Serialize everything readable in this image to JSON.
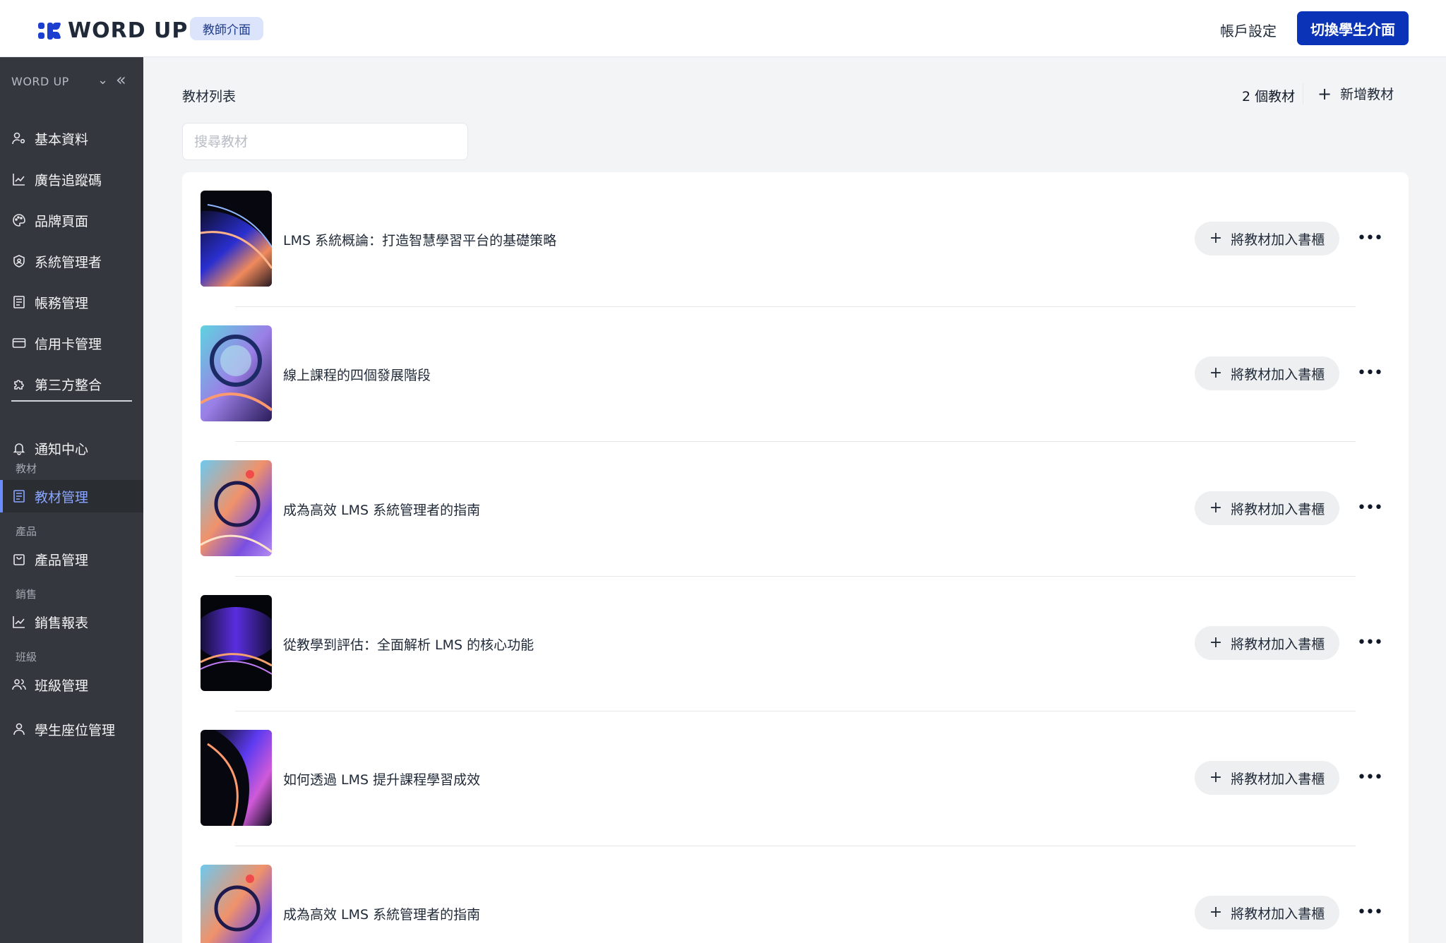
{
  "header": {
    "logo_text": "WORD UP",
    "role_badge": "教師介面",
    "account_settings": "帳戶設定",
    "switch_button": "切換學生介面",
    "accent_color": "#0a33b8"
  },
  "sidebar": {
    "brand": "WORD UP",
    "items": [
      {
        "label": "基本資料",
        "icon": "user-settings-icon"
      },
      {
        "label": "廣告追蹤碼",
        "icon": "line-chart-icon"
      },
      {
        "label": "品牌頁面",
        "icon": "palette-icon"
      },
      {
        "label": "系統管理者",
        "icon": "shield-icon"
      },
      {
        "label": "帳務管理",
        "icon": "document-icon"
      },
      {
        "label": "信用卡管理",
        "icon": "credit-card-icon"
      },
      {
        "label": "第三方整合",
        "icon": "puzzle-icon"
      },
      {
        "label": "通知中心",
        "icon": "bell-icon"
      }
    ],
    "sections": [
      {
        "label": "教材",
        "item": {
          "label": "教材管理",
          "icon": "book-icon",
          "active": true
        }
      },
      {
        "label": "產品",
        "item": {
          "label": "產品管理",
          "icon": "shopping-bag-icon"
        }
      },
      {
        "label": "銷售",
        "item": {
          "label": "銷售報表",
          "icon": "line-chart-icon"
        }
      },
      {
        "label": "班級",
        "item": {
          "label": "班級管理",
          "icon": "users-icon"
        }
      }
    ],
    "extra_item": {
      "label": "學生座位管理",
      "icon": "user-icon"
    }
  },
  "main": {
    "title": "教材列表",
    "count": "2 個教材",
    "add_label": "新增教材",
    "search_placeholder": "搜尋教材",
    "shelf_button_label": "將教材加入書櫃",
    "materials": [
      {
        "title": "LMS 系統概論：打造智慧學習平台的基礎策略"
      },
      {
        "title": "線上課程的四個發展階段"
      },
      {
        "title": "成為高效 LMS 系統管理者的指南"
      },
      {
        "title": "從教學到評估：全面解析 LMS 的核心功能"
      },
      {
        "title": "如何透過 LMS 提升課程學習成效"
      },
      {
        "title": "成為高效 LMS 系統管理者的指南"
      }
    ]
  }
}
